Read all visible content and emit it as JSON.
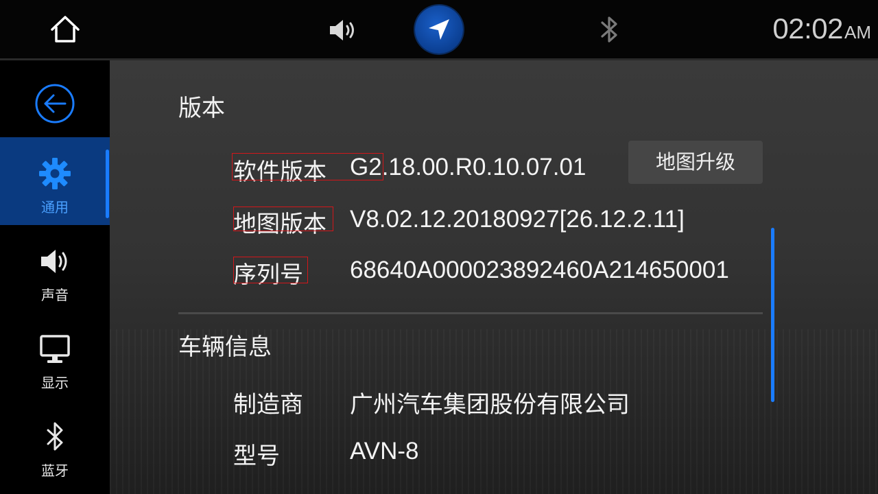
{
  "topbar": {
    "home_icon": "home-icon",
    "volume_icon": "volume-icon",
    "navigation_icon": "navigation-arrow-icon",
    "bluetooth_icon": "bluetooth-icon",
    "clock": {
      "time": "02:02",
      "ampm": "AM"
    }
  },
  "sidebar": {
    "back_icon": "back-arrow-icon",
    "items": [
      {
        "label": "通用",
        "icon": "gear-icon",
        "active": true
      },
      {
        "label": "声音",
        "icon": "speaker-icon",
        "active": false
      },
      {
        "label": "显示",
        "icon": "monitor-icon",
        "active": false
      },
      {
        "label": "蓝牙",
        "icon": "bluetooth-icon",
        "active": false
      }
    ]
  },
  "main": {
    "version_section": {
      "title": "版本",
      "software_version": {
        "label": "软件版本",
        "value": "G2.18.00.R0.10.07.01"
      },
      "map_version": {
        "label": "地图版本",
        "value": "V8.02.12.20180927[26.12.2.11]"
      },
      "serial_number": {
        "label": "序列号",
        "value": "68640A000023892460A214650001"
      },
      "map_upgrade_button": "地图升级"
    },
    "vehicle_section": {
      "title": "车辆信息",
      "manufacturer": {
        "label": "制造商",
        "value": "广州汽车集团股份有限公司"
      },
      "model": {
        "label": "型号",
        "value": "AVN-8"
      }
    }
  },
  "colors": {
    "accent_blue": "#1a7cff",
    "active_item_bg": "#0a3a80",
    "nav_button": "#0b3f92",
    "highlight_box": "#d4161a",
    "panel_bg": "#333333"
  }
}
